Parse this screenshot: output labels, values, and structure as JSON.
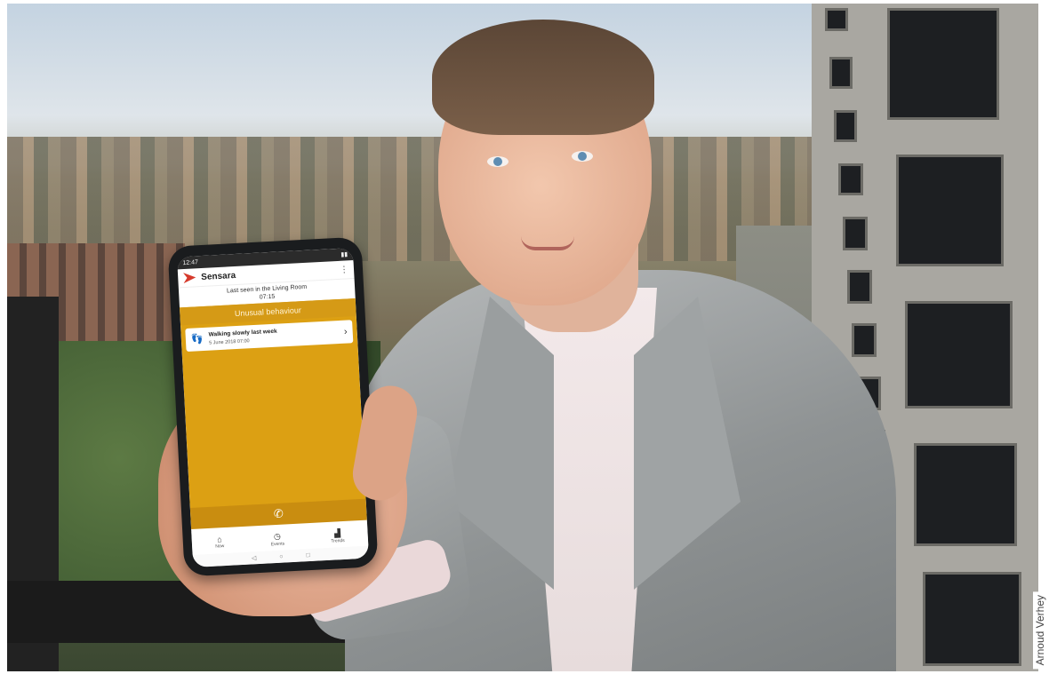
{
  "photo_credit": "Arnoud Verhey",
  "phone": {
    "status_time": "12:47",
    "app_name": "Sensara",
    "last_seen_line1": "Last seen in the Living Room",
    "last_seen_line2": "07:15",
    "banner": "Unusual behaviour",
    "event_title": "Walking slowly last week",
    "event_date": "5 June 2018 07:00",
    "nav": [
      {
        "label": "Now",
        "icon": "home-icon"
      },
      {
        "label": "Events",
        "icon": "clock-icon"
      },
      {
        "label": "Trends",
        "icon": "chart-icon"
      }
    ]
  },
  "colors": {
    "accent": "#dca013",
    "brand": "#d63a2c"
  }
}
